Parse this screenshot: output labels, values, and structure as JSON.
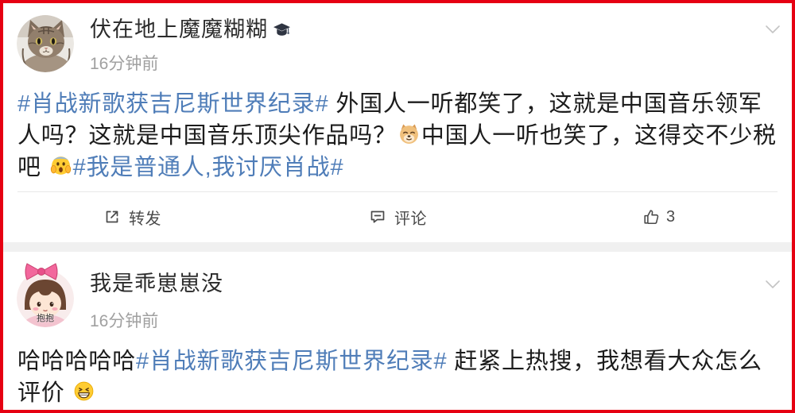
{
  "theme": {
    "frame_border": "#e60012",
    "text": "#1c1c1c",
    "name": "#2b2b2b",
    "hashtag": "#4f7db8",
    "meta": "#a0a0a0",
    "action": "#4a4a4a",
    "divider": "#e8e8e8",
    "separator": "#f0f0f0",
    "chevron": "#c4c4c4"
  },
  "posts": [
    {
      "author": {
        "name": "伏在地上魔魔糊糊",
        "avatar": "cat-photo-avatar",
        "badge": "graduation-cap-icon"
      },
      "time": "16分钟前",
      "menu_icon": "chevron-down-icon",
      "lines": [
        [
          {
            "hashtag": "#肖战新歌获吉尼斯世界纪录#"
          },
          {
            "text": " 外国人一听都笑了，这就是中国音乐领军"
          }
        ],
        [
          {
            "text": "人吗？这就是中国音乐顶尖作品吗？"
          },
          {
            "emoji": "doge-emoji"
          },
          {
            "text": "中国人一听也笑了，这得交不少税"
          }
        ],
        [
          {
            "text": "吧 "
          },
          {
            "emoji": "screaming-face-emoji"
          },
          {
            "hashtag": "#我是普通人,我讨厌肖战#"
          }
        ]
      ],
      "actions": {
        "repost": {
          "icon": "share-icon",
          "label": "转发"
        },
        "comment": {
          "icon": "comment-icon",
          "label": "评论"
        },
        "like": {
          "icon": "like-icon",
          "count": "3"
        }
      }
    },
    {
      "author": {
        "name": "我是乖崽崽没",
        "avatar": "cartoon-girl-avatar",
        "avatar_decoration": "pink-bow-icon",
        "avatar_caption": "抱抱"
      },
      "time": "16分钟前",
      "menu_icon": "chevron-down-icon",
      "lines": [
        [
          {
            "text": "哈哈哈哈哈"
          },
          {
            "hashtag": "#肖战新歌获吉尼斯世界纪录#"
          },
          {
            "text": " 赶紧上热搜，我想看大众怎么"
          }
        ],
        [
          {
            "text": "评价 "
          },
          {
            "emoji": "grinning-face-emoji"
          }
        ]
      ]
    }
  ]
}
